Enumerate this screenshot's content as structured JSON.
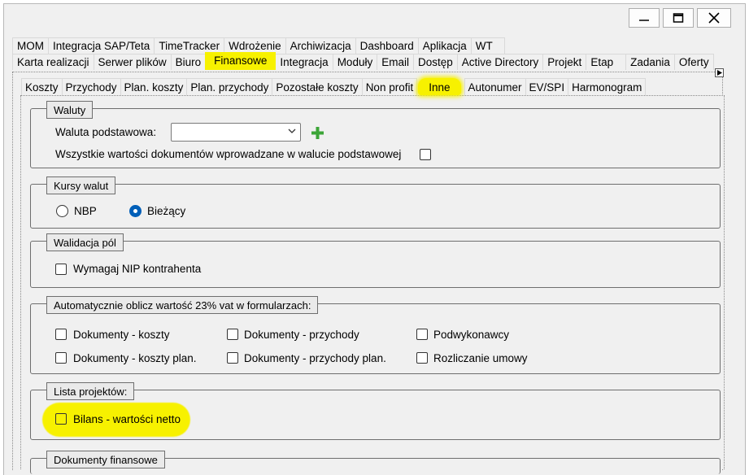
{
  "window_controls": {
    "minimize": "minimize",
    "maximize": "maximize",
    "close": "close"
  },
  "tabs_row1": [
    "MOM",
    "Integracja SAP/Teta",
    "TimeTracker",
    "Wdrożenie",
    "Archiwizacja",
    "Dashboard",
    "Aplikacja",
    "WT"
  ],
  "tabs_row2": [
    "Karta realizacji",
    "Serwer plików",
    "Biuro",
    "Finansowe",
    "Integracja",
    "Moduły",
    "Email",
    "Dostęp",
    "Active Directory",
    "Projekt",
    "Etap",
    "Zadania",
    "Oferty"
  ],
  "subtabs": [
    "Koszty",
    "Przychody",
    "Plan. koszty",
    "Plan. przychody",
    "Pozostałe koszty",
    "Non profit",
    "Inne",
    "Autonumer",
    "EV/SPI",
    "Harmonogram"
  ],
  "waluty": {
    "title": "Waluty",
    "base_label": "Waluta podstawowa:",
    "base_value": "",
    "all_label": "Wszystkie wartości dokumentów wprowadzane w walucie podstawowej"
  },
  "kursy": {
    "title": "Kursy walut",
    "opt_nbp": "NBP",
    "opt_current": "Bieżący",
    "selected": "Bieżący"
  },
  "walidacja": {
    "title": "Walidacja pól",
    "nip_label": "Wymagaj NIP kontrahenta"
  },
  "vat": {
    "title": "Automatycznie oblicz wartość 23% vat  w formularzach:",
    "c1": "Dokumenty - koszty",
    "c2": "Dokumenty - przychody",
    "c3": "Podwykonawcy",
    "c4": "Dokumenty - koszty plan.",
    "c5": "Dokumenty - przychody plan.",
    "c6": "Rozliczanie umowy"
  },
  "lista": {
    "title": "Lista projektów:",
    "bilans_label": "Bilans - wartości netto"
  },
  "dokumenty": {
    "title": "Dokumenty finansowe"
  },
  "colors": {
    "highlight": "#f7f100",
    "radio_selected": "#005fb8",
    "plus": "#3ca537"
  }
}
